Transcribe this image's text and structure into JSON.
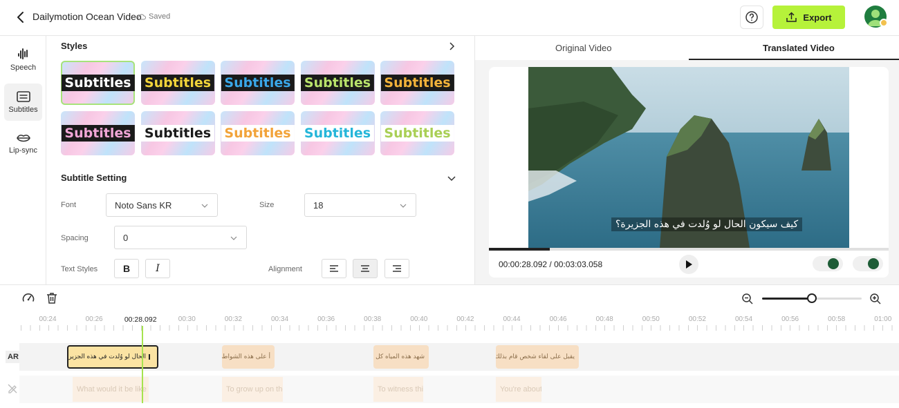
{
  "header": {
    "title": "Dailymotion Ocean Video",
    "saved": "Saved",
    "export_label": "Export"
  },
  "rail": {
    "items": [
      {
        "label": "Speech",
        "icon": "waveform-icon"
      },
      {
        "label": "Subtitles",
        "icon": "subtitles-icon",
        "active": true
      },
      {
        "label": "Lip-sync",
        "icon": "lips-icon"
      }
    ]
  },
  "styles": {
    "title": "Styles",
    "cards": [
      {
        "text": "Subtitles",
        "color": "#ffffff",
        "bg": "#1a1a1a",
        "selected": true
      },
      {
        "text": "Subtitles",
        "color": "#f2d43a",
        "bg": "#1a1a1a"
      },
      {
        "text": "Subtitles",
        "color": "#3aa7e8",
        "bg": "#1a1a1a"
      },
      {
        "text": "Subtitles",
        "color": "#b9e36b",
        "bg": "#1a1a1a"
      },
      {
        "text": "Subtitles",
        "color": "#f2b23a",
        "bg": "#1a1a1a"
      },
      {
        "text": "Subtitles",
        "color": "#f0a6d6",
        "bg": "#1a1a1a"
      },
      {
        "text": "Subtitles",
        "color": "#1a1a1a",
        "bg": "#ffffff"
      },
      {
        "text": "Subtitles",
        "color": "#f2a33a",
        "bg": "#ffffff"
      },
      {
        "text": "Subtitles",
        "color": "#25b6d9",
        "bg": "#ffffff"
      },
      {
        "text": "Subtitles",
        "color": "#a9cf55",
        "bg": "#ffffff"
      }
    ]
  },
  "subtitle_setting": {
    "title": "Subtitle Setting",
    "font_label": "Font",
    "font_value": "Noto Sans KR",
    "size_label": "Size",
    "size_value": "18",
    "spacing_label": "Spacing",
    "spacing_value": "0",
    "text_styles_label": "Text Styles",
    "bold": "B",
    "italic": "I",
    "alignment_label": "Alignment"
  },
  "preview": {
    "tab_original": "Original Video",
    "tab_translated": "Translated Video",
    "overlay_text": "كيف سيكون الحال لو وُلدت في هذه الجزيرة؟",
    "timecode": "00:00:28.092 / 00:03:03.058",
    "progress": 0.153
  },
  "timeline": {
    "zoom": 0.5,
    "ruler": [
      "00:24",
      "00:26",
      "00:28.092",
      "00:30",
      "00:32",
      "00:34",
      "00:36",
      "00:38",
      "00:40",
      "00:42",
      "00:44",
      "00:46",
      "00:48",
      "00:50",
      "00:52",
      "00:54",
      "00:56",
      "00:58",
      "01:00"
    ],
    "current": "00:00:28.092",
    "track_label": "AR",
    "ar_clips": [
      "الحال لو وُلدت في هذه الجزيرة؟",
      "أ على هذه الشواطئ؛",
      "شهد هذه المياه كل يوم",
      "يقبل على لقاء شخص قام بذلك"
    ],
    "orig_clips": [
      "What would it be like",
      "To grow up on the",
      "To witness thi",
      "You're about"
    ]
  },
  "colors": {
    "accent": "#b6f23a",
    "playhead": "#a6e34f",
    "clip": "#f7dfc4",
    "clip_selected": "#fbe3a3"
  }
}
